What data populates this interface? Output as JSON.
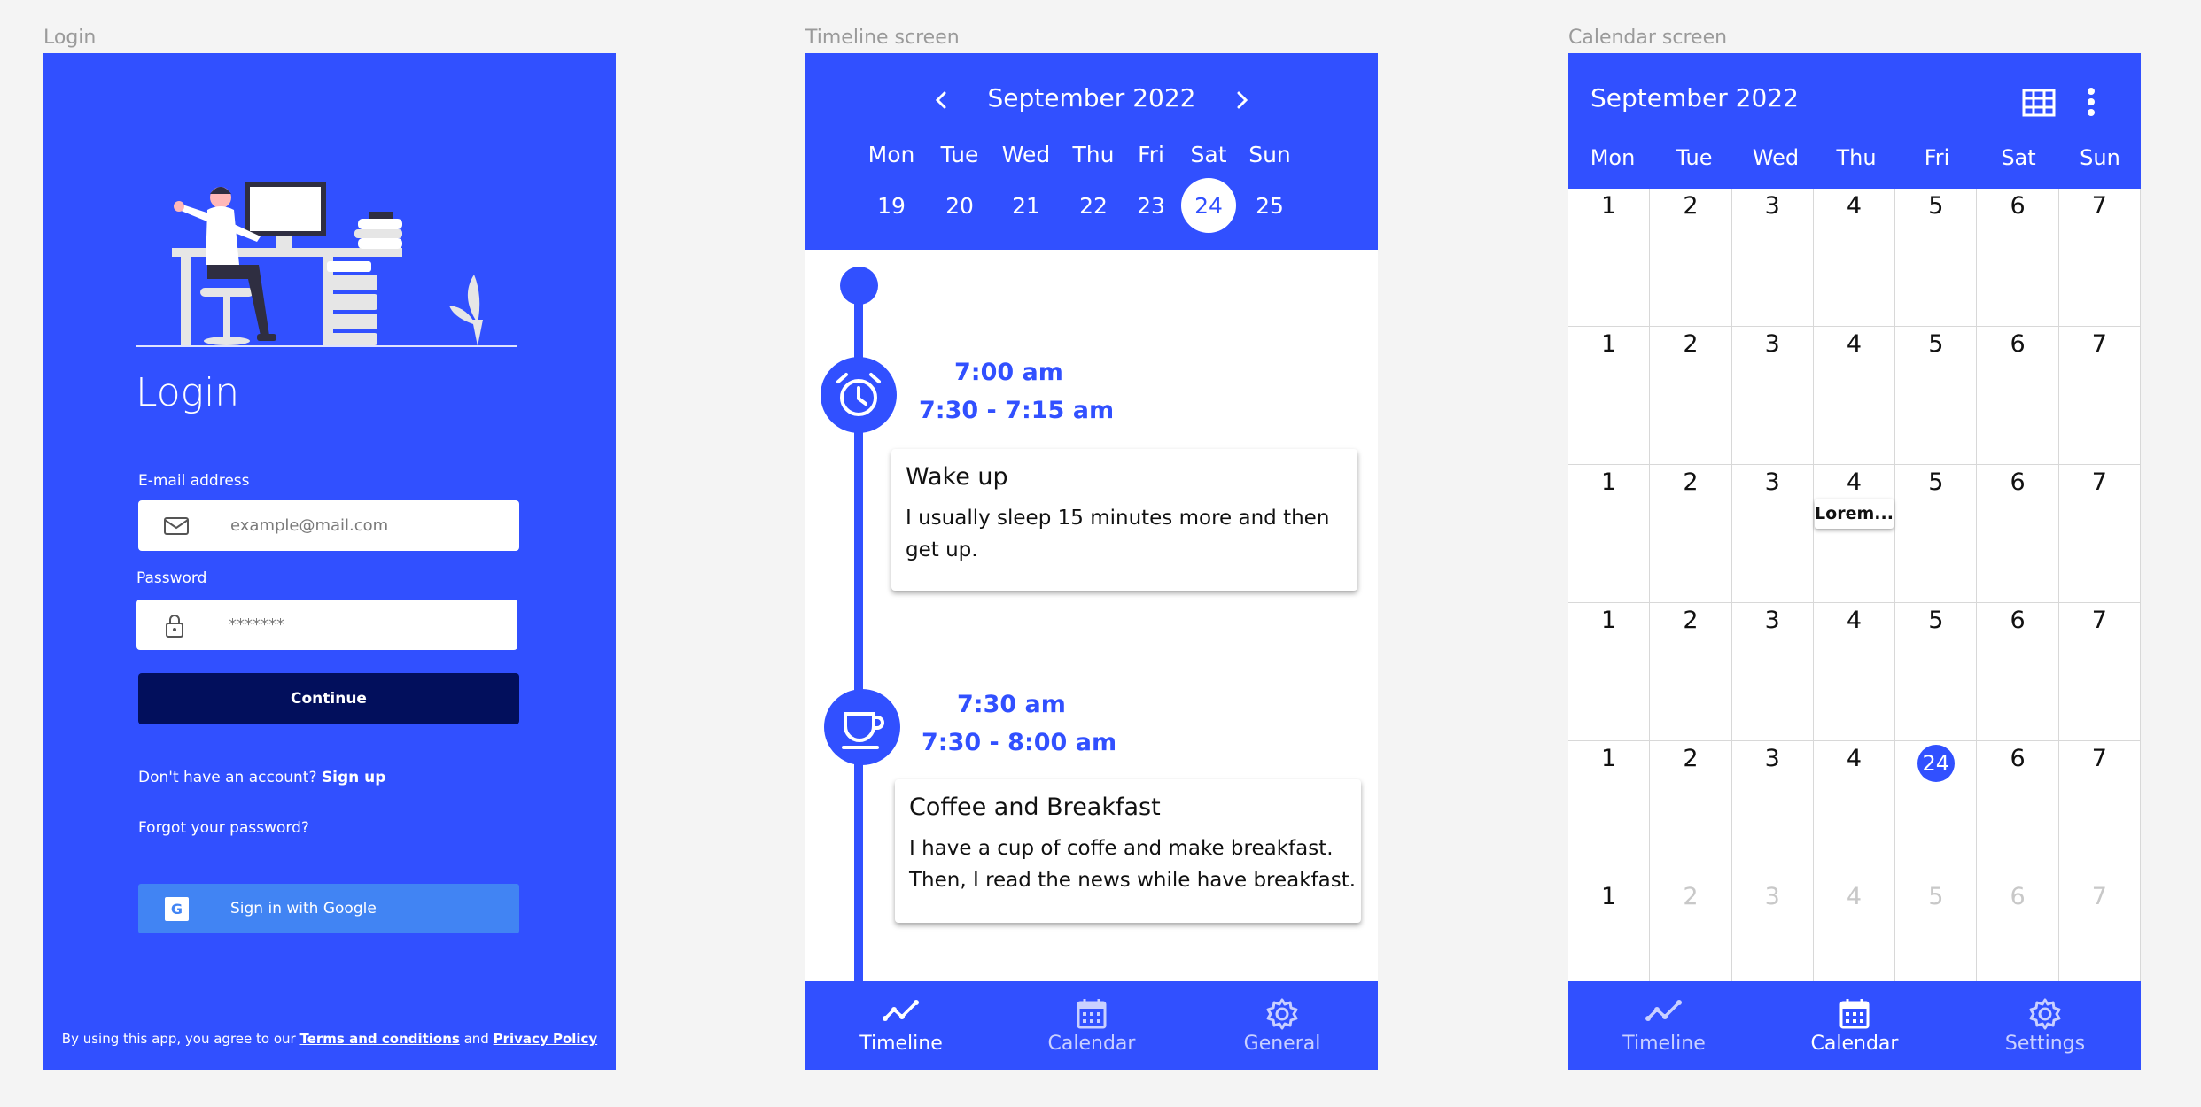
{
  "frames": {
    "login_label": "Login",
    "timeline_label": "Timeline screen",
    "calendar_label": "Calendar screen"
  },
  "colors": {
    "primary": "#3150ff",
    "dark_button": "#020f5c",
    "google_blue": "#4184f3",
    "canvas": "#f4f4f4"
  },
  "login": {
    "title": "Login",
    "email_label": "E-mail address",
    "email_placeholder": "example@mail.com",
    "password_label": "Password",
    "password_placeholder": "*******",
    "continue_label": "Continue",
    "no_account_text": "Don't have an account?",
    "signup_link": "Sign up",
    "forgot_password": "Forgot your password?",
    "google_label": "Sign in with Google",
    "google_glyph": "G",
    "terms_prefix": "By using this app, you agree to our",
    "terms_link": "Terms and conditions",
    "terms_and": "and",
    "privacy_link": "Privacy Policy"
  },
  "timeline": {
    "month": "September 2022",
    "day_names": [
      "Mon",
      "Tue",
      "Wed",
      "Thu",
      "Fri",
      "Sat",
      "Sun"
    ],
    "day_numbers": [
      "19",
      "20",
      "21",
      "22",
      "23",
      "24",
      "25"
    ],
    "selected_day": "24",
    "events": [
      {
        "icon": "alarm-clock-icon",
        "time": "7:00 am",
        "range": "7:30 - 7:15 am",
        "title": "Wake up",
        "description": "I usually sleep 15 minutes more and then get up."
      },
      {
        "icon": "coffee-cup-icon",
        "time": "7:30 am",
        "range": "7:30 - 8:00 am",
        "title": "Coffee and Breakfast",
        "description": "I have a cup of coffe and make breakfast. Then, I read the news while have breakfast."
      }
    ],
    "nav": [
      {
        "label": "Timeline",
        "icon": "trend-line-icon",
        "active": true
      },
      {
        "label": "Calendar",
        "icon": "calendar-icon",
        "active": false
      },
      {
        "label": "General",
        "icon": "gear-icon",
        "active": false
      }
    ]
  },
  "calendar": {
    "month": "September 2022",
    "day_names": [
      "Mon",
      "Tue",
      "Wed",
      "Thu",
      "Fri",
      "Sat",
      "Sun"
    ],
    "weeks": [
      [
        "1",
        "2",
        "3",
        "4",
        "5",
        "6",
        "7"
      ],
      [
        "1",
        "2",
        "3",
        "4",
        "5",
        "6",
        "7"
      ],
      [
        "1",
        "2",
        "3",
        "4",
        "5",
        "6",
        "7"
      ],
      [
        "1",
        "2",
        "3",
        "4",
        "5",
        "6",
        "7"
      ],
      [
        "1",
        "2",
        "3",
        "4",
        "24",
        "6",
        "7"
      ],
      [
        "1",
        "2",
        "3",
        "4",
        "5",
        "6",
        "7"
      ]
    ],
    "today": "24",
    "event_label": "Lorem...",
    "nav": [
      {
        "label": "Timeline",
        "icon": "trend-line-icon",
        "active": false
      },
      {
        "label": "Calendar",
        "icon": "calendar-icon",
        "active": true
      },
      {
        "label": "Settings",
        "icon": "gear-icon",
        "active": false
      }
    ]
  }
}
